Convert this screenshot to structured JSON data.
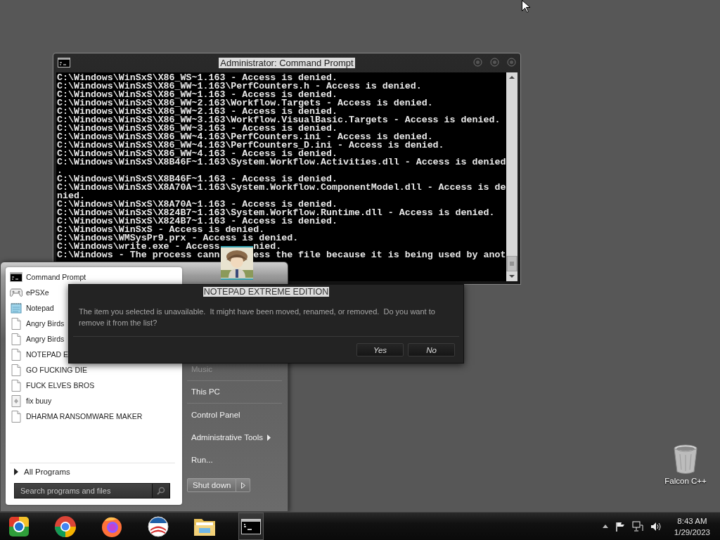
{
  "console_window": {
    "title": "Administrator: Command Prompt",
    "lines": [
      "C:\\Windows\\WinSxS\\X86_WS~1.163 - Access is denied.",
      "C:\\Windows\\WinSxS\\X86_WW~1.163\\PerfCounters.h - Access is denied.",
      "C:\\Windows\\WinSxS\\X86_WW~1.163 - Access is denied.",
      "C:\\Windows\\WinSxS\\X86_WW~2.163\\Workflow.Targets - Access is denied.",
      "C:\\Windows\\WinSxS\\X86_WW~2.163 - Access is denied.",
      "C:\\Windows\\WinSxS\\X86_WW~3.163\\Workflow.VisualBasic.Targets - Access is denied.",
      "C:\\Windows\\WinSxS\\X86_WW~3.163 - Access is denied.",
      "C:\\Windows\\WinSxS\\X86_WW~4.163\\PerfCounters.ini - Access is denied.",
      "C:\\Windows\\WinSxS\\X86_WW~4.163\\PerfCounters_D.ini - Access is denied.",
      "C:\\Windows\\WinSxS\\X86_WW~4.163 - Access is denied.",
      "C:\\Windows\\WinSxS\\X8B46F~1.163\\System.Workflow.Activities.dll - Access is denied",
      ".",
      "C:\\Windows\\WinSxS\\X8B46F~1.163 - Access is denied.",
      "C:\\Windows\\WinSxS\\X8A70A~1.163\\System.Workflow.ComponentModel.dll - Access is de",
      "nied.",
      "C:\\Windows\\WinSxS\\X8A70A~1.163 - Access is denied.",
      "C:\\Windows\\WinSxS\\X824B7~1.163\\System.Workflow.Runtime.dll - Access is denied.",
      "C:\\Windows\\WinSxS\\X824B7~1.163 - Access is denied.",
      "C:\\Windows\\WinSxS - Access is denied.",
      "C:\\Windows\\WMSysPr9.prx - Access is denied.",
      [
        "C:\\Windows\\write.exe - Access",
        "nied."
      ],
      [
        "C:\\Windows - The process cann",
        "ess the file because it is being used by anot"
      ]
    ]
  },
  "start_menu": {
    "programs": [
      {
        "label": "Command Prompt",
        "kind": "terminal"
      },
      {
        "label": "ePSXe",
        "kind": "gamepad"
      },
      {
        "label": "Notepad",
        "kind": "notepad"
      },
      {
        "label": "Angry Birds",
        "kind": "file"
      },
      {
        "label": "Angry Birds",
        "kind": "file"
      },
      {
        "label": "NOTEPAD E",
        "kind": "file"
      },
      {
        "label": "GO FUCKING DIE",
        "kind": "file"
      },
      {
        "label": "FUCK ELVES BROS",
        "kind": "file"
      },
      {
        "label": "fix buuy",
        "kind": "setup"
      },
      {
        "label": "DHARMA RANSOMWARE MAKER",
        "kind": "file"
      }
    ],
    "all_programs": "All Programs",
    "search": {
      "placeholder": "Search programs and files"
    },
    "places": [
      {
        "label": "Music",
        "disabled": true,
        "submenu": false
      },
      {
        "label": "This PC",
        "disabled": false,
        "submenu": false
      },
      {
        "label": "Control Panel",
        "disabled": false,
        "submenu": false
      },
      {
        "label": "Administrative Tools",
        "disabled": false,
        "submenu": true
      },
      {
        "label": "Run...",
        "disabled": false,
        "submenu": false
      }
    ],
    "shutdown": "Shut down"
  },
  "dialog": {
    "title": "NOTEPAD EXTREME EDITION",
    "message": "The item you selected is unavailable.  It might have been moved, renamed, or removed.  Do you want to remove it from the list?",
    "buttons": [
      "Yes",
      "No"
    ]
  },
  "desktop_icons": [
    {
      "label": "Falcon C++"
    }
  ],
  "taskbar": {
    "apps": [
      {
        "kind": "ball",
        "active": false
      },
      {
        "kind": "chrome",
        "active": false
      },
      {
        "kind": "firefox",
        "active": false
      },
      {
        "kind": "sunrise",
        "active": false
      },
      {
        "kind": "folder",
        "active": false
      },
      {
        "kind": "terminal",
        "active": true
      }
    ],
    "time": "8:43 AM",
    "date": "1/29/2023"
  }
}
